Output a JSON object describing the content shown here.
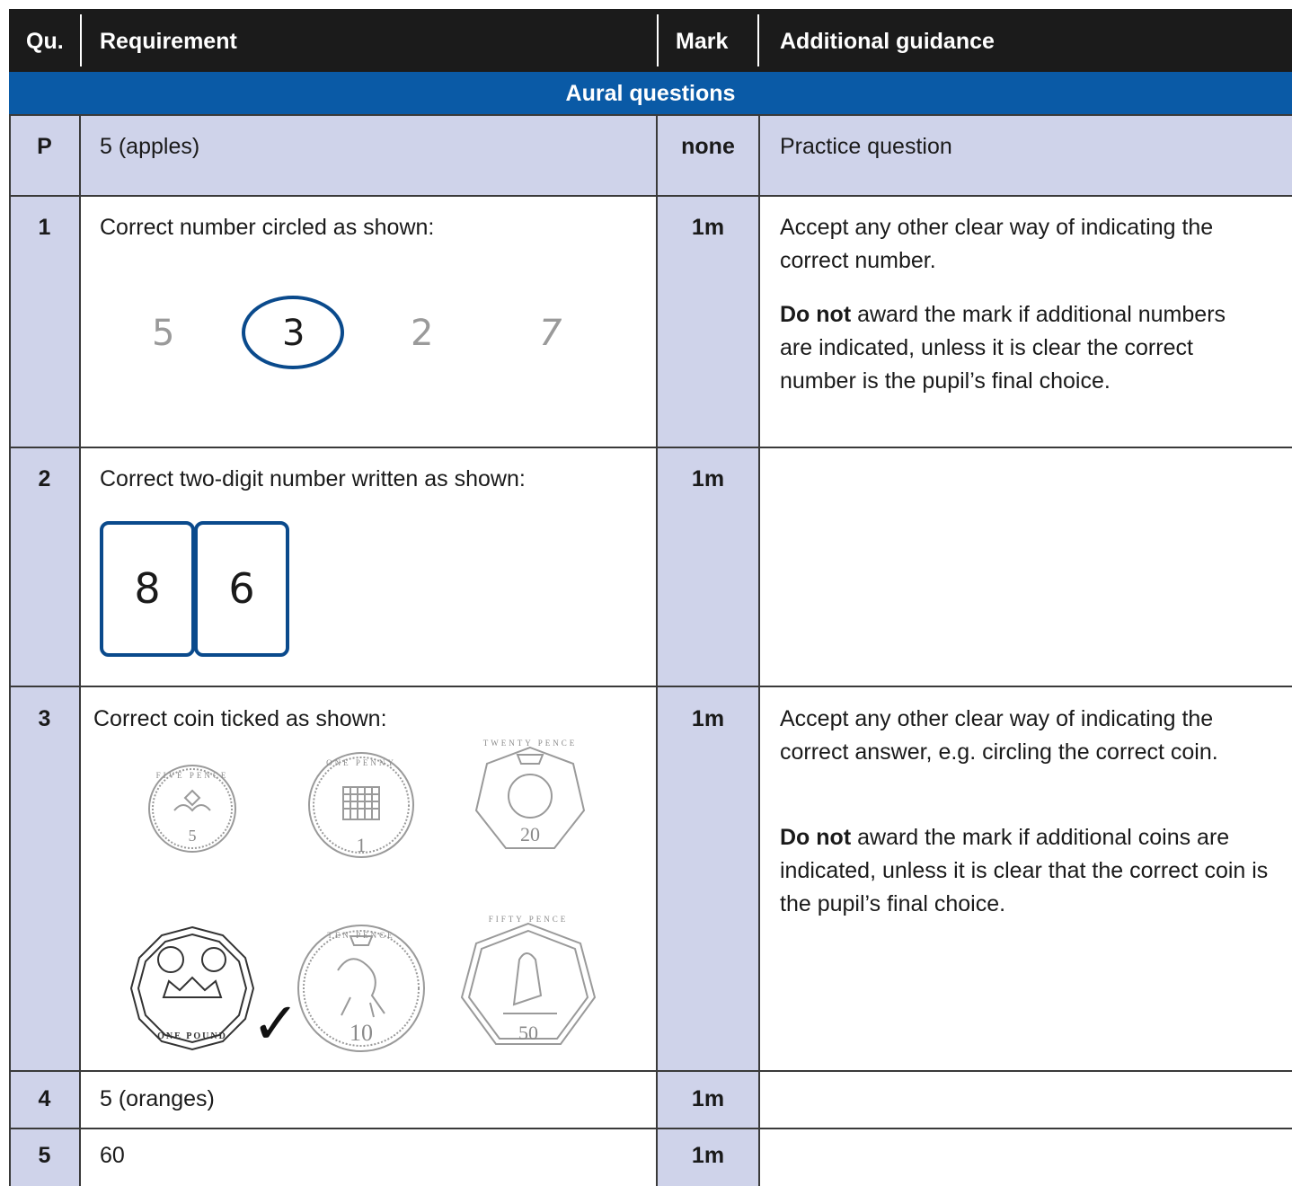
{
  "header": {
    "qu": "Qu.",
    "requirement": "Requirement",
    "mark": "Mark",
    "guidance": "Additional guidance"
  },
  "section": {
    "title": "Aural questions"
  },
  "colors": {
    "header_bg": "#1b1b1b",
    "section_bg": "#0a5aa6",
    "shade": "#cfd3ea",
    "accent": "#0a4a8c"
  },
  "rows": [
    {
      "qu": "P",
      "requirement": "5 (apples)",
      "mark": "none",
      "guidance": [
        "Practice question"
      ]
    },
    {
      "qu": "1",
      "requirement": "Correct number circled as shown:",
      "mark": "1m",
      "guidance": [
        "Accept any other clear way of indicating the correct number.",
        "award the mark if additional numbers are indicated, unless it is clear the correct number is the pupil’s final choice."
      ],
      "guidance_bold_prefix": "Do not",
      "numbers": [
        "5",
        "3",
        "2",
        "7"
      ],
      "circled": "3"
    },
    {
      "qu": "2",
      "requirement": "Correct two-digit number written as shown:",
      "mark": "1m",
      "digits": [
        "8",
        "6"
      ]
    },
    {
      "qu": "3",
      "requirement": "Correct coin ticked as shown:",
      "mark": "1m",
      "guidance": [
        "Accept any other clear way of indicating the correct answer, e.g. circling the correct coin.",
        "award the mark if additional coins are indicated, unless it is clear that the correct coin is the pupil’s final choice."
      ],
      "guidance_bold_prefix": "Do not",
      "coins": [
        {
          "name": "five-pence",
          "value": "5",
          "text": "FIVE PENCE"
        },
        {
          "name": "one-penny",
          "value": "1",
          "text": "ONE PENNY"
        },
        {
          "name": "twenty-pence",
          "value": "20",
          "text": "TWENTY PENCE"
        },
        {
          "name": "one-pound",
          "value": "",
          "text": "ONE POUND"
        },
        {
          "name": "ten-pence",
          "value": "10",
          "text": "TEN PENCE"
        },
        {
          "name": "fifty-pence",
          "value": "50",
          "text": "FIFTY PENCE"
        }
      ],
      "ticked": "one-pound",
      "tick": "✓"
    },
    {
      "qu": "4",
      "requirement": "5 (oranges)",
      "mark": "1m"
    },
    {
      "qu": "5",
      "requirement": "60",
      "mark": "1m"
    }
  ]
}
